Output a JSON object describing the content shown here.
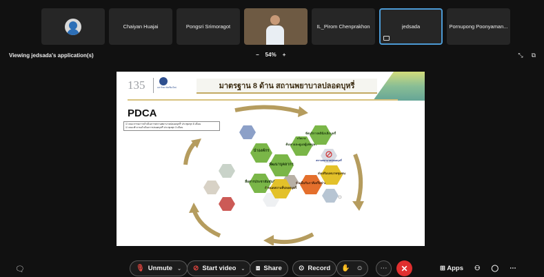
{
  "participants": [
    {
      "name": "",
      "kind": "avatar"
    },
    {
      "name": "Chaiyan Huajai",
      "kind": "name"
    },
    {
      "name": "Pongsri Srimoragot",
      "kind": "name"
    },
    {
      "name": "",
      "kind": "video"
    },
    {
      "name": "IL_Pirom Chenprakhon",
      "kind": "name"
    },
    {
      "name": "jedsada",
      "kind": "name",
      "active": true
    },
    {
      "name": "Pornupong Poonyaman...",
      "kind": "name"
    }
  ],
  "viewing": "Viewing jedsada's application(s)",
  "zoom": {
    "minus": "−",
    "level": "54%",
    "plus": "+"
  },
  "slide": {
    "logo": "135",
    "logo_caption": "มหาวิทยาลัยเชียงใหม่",
    "title": "มาตรฐาน 8 ด้าน สถานพยาบาลปลอดบุหรี่",
    "pdca": "PDCA",
    "checklist": [
      "☑ คณะกรรมการดำเนินการสถานพยาบาลปลอดบุหรี่ ประชุมทุก 6 เดือน",
      "☑ คณะทำงานดำเนินการปลอดบุหรี่ ประชุมทุก 3 เดือน"
    ],
    "hex_labels": {
      "lead": "นำองค์กร",
      "develop": "พัฒนาบุคลากร",
      "communicate": "สื่อสารประชาสัมพันธ์",
      "care": "ค้นหาและดูแลผู้เสพบุหรี่",
      "ethics": "จัดบริการคลินิกเลิกบุหรี่",
      "signs": "กำหนดสถานที่ปลอดบุหรี่",
      "network": "ร่วมมือกับภาคีเครือข่าย",
      "community": "ส่งเสริมบทบาทชุมชน",
      "nosmoke_caption": "สถานพยาบาลปลอดบุหรี่",
      "center_top": "นโยบาย"
    }
  },
  "toolbar": {
    "unmute": "Unmute",
    "start_video": "Start video",
    "share": "Share",
    "record": "Record",
    "apps": "Apps"
  },
  "colors": {
    "background": "#111111",
    "tile": "#262626",
    "active_border": "#4c9bd6",
    "leave": "#e02f2f",
    "hex_green": "#7ab648",
    "hex_yellow": "#e3c12a",
    "hex_orange": "#e46f2c",
    "arrow": "#b59c5e"
  }
}
